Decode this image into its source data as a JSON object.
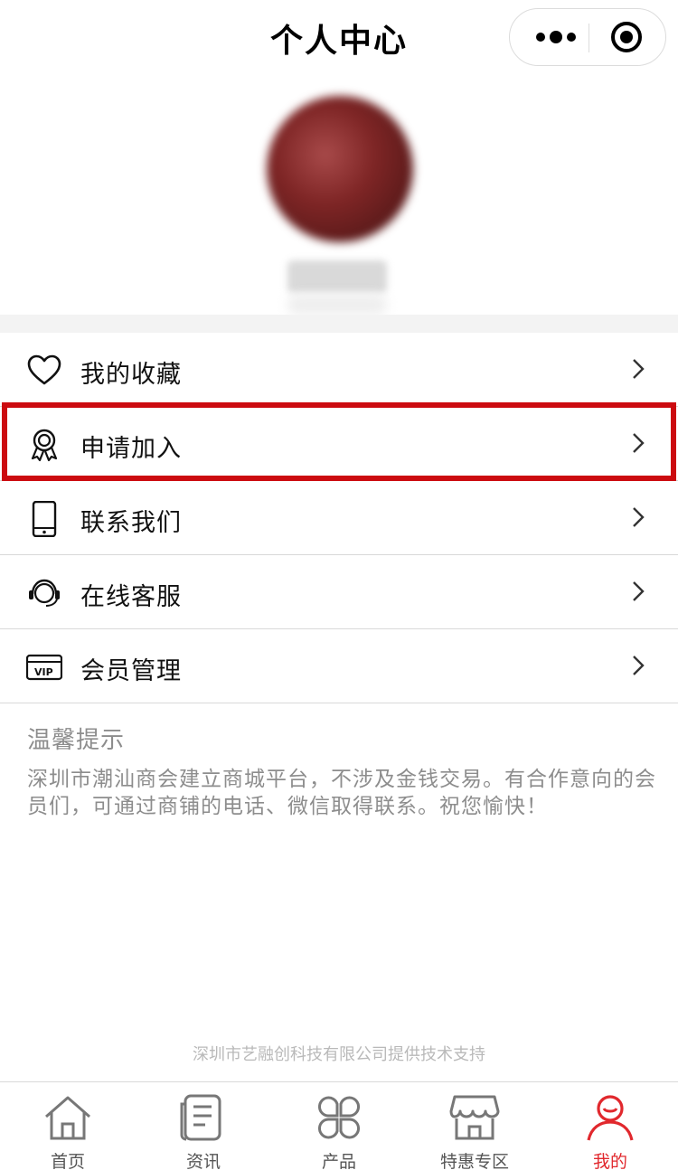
{
  "navbar": {
    "title": "个人中心"
  },
  "menu": [
    {
      "label": "我的收藏",
      "icon": "heart-icon"
    },
    {
      "label": "申请加入",
      "icon": "award-badge-icon"
    },
    {
      "label": "联系我们",
      "icon": "phone-icon"
    },
    {
      "label": "在线客服",
      "icon": "headset-icon"
    },
    {
      "label": "会员管理",
      "icon": "vip-card-icon"
    }
  ],
  "tips": {
    "title": "温馨提示",
    "text": "深圳市潮汕商会建立商城平台，不涉及金钱交易。有合作意向的会员们，可通过商铺的电话、微信取得联系。祝您愉快！"
  },
  "support": "深圳市艺融创科技有限公司提供技术支持",
  "tabbar": [
    {
      "label": "首页",
      "icon": "home-icon"
    },
    {
      "label": "资讯",
      "icon": "news-icon"
    },
    {
      "label": "产品",
      "icon": "products-icon"
    },
    {
      "label": "特惠专区",
      "icon": "store-icon"
    },
    {
      "label": "我的",
      "icon": "user-icon",
      "active": true
    }
  ],
  "colors": {
    "accent": "#e1282d",
    "highlight": "#cc0b10",
    "tip_text": "#8d8d8d"
  }
}
